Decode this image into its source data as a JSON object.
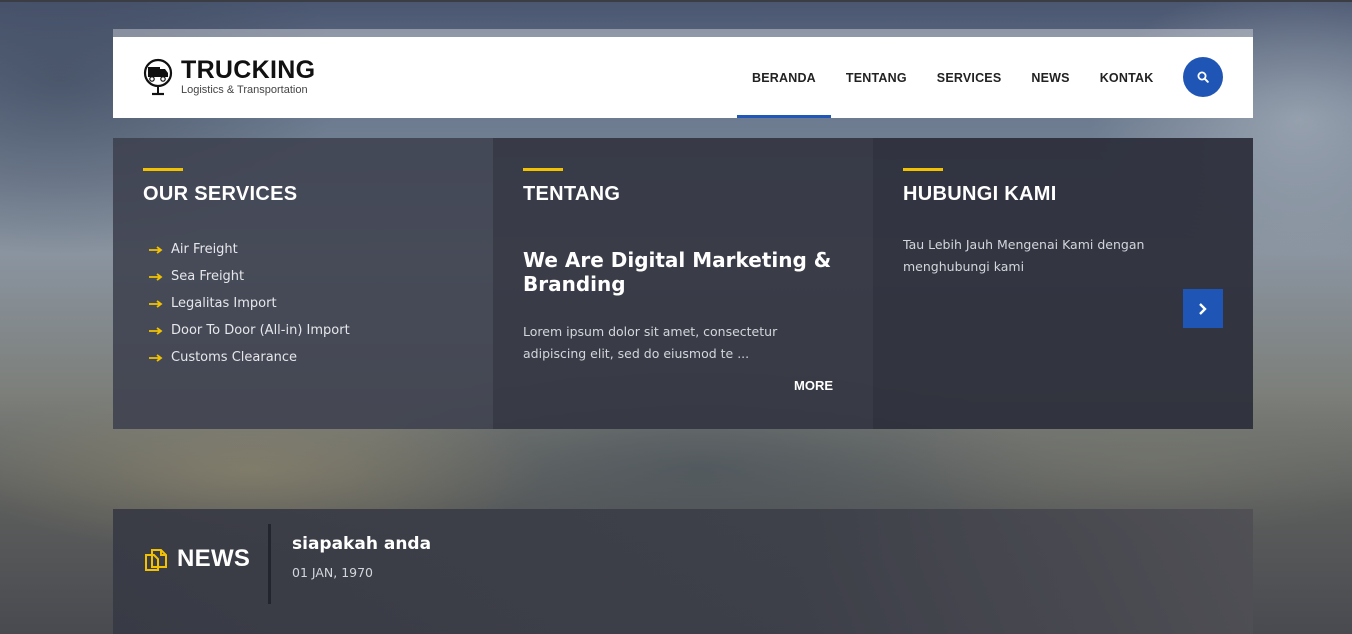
{
  "header": {
    "logo_title": "TRUCKING",
    "logo_subtitle": "Logistics & Transportation",
    "nav": [
      "BERANDA",
      "TENTANG",
      "SERVICES",
      "NEWS",
      "KONTAK"
    ],
    "active_nav": "BERANDA",
    "search_icon": "search-icon"
  },
  "services": {
    "title": "OUR SERVICES",
    "items": [
      "Air Freight",
      "Sea Freight",
      "Legalitas Import",
      "Door To Door (All-in) Import",
      "Customs Clearance"
    ]
  },
  "about": {
    "title": "TENTANG",
    "headline": "We Are Digital Marketing & Branding",
    "text": "Lorem ipsum dolor sit amet, consectetur adipiscing elit, sed do eiusmod te ...",
    "more": "MORE"
  },
  "contact": {
    "title": "HUBUNGI KAMI",
    "text": "Tau Lebih Jauh Mengenai Kami dengan menghubungi kami"
  },
  "news": {
    "label": "NEWS",
    "items": [
      {
        "title": "siapakah anda",
        "date": "01 JAN, 1970"
      }
    ]
  },
  "colors": {
    "accent_yellow": "#f2c200",
    "primary_blue": "#1f56b6"
  }
}
